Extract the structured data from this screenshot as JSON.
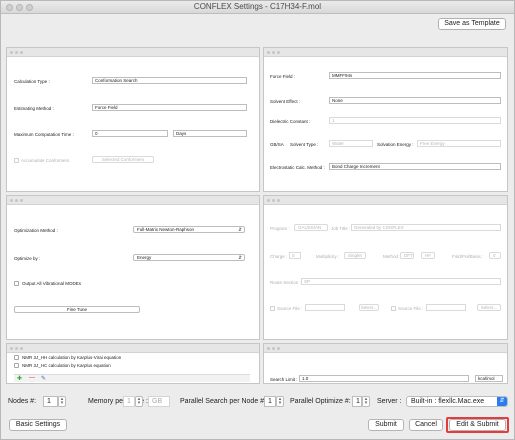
{
  "window": {
    "title": "CONFLEX Settings - C17H34-F.mol"
  },
  "toolbar": {
    "save_template": "Save as Template"
  },
  "panel_calc": {
    "calc_type_label": "Calculation Type :",
    "calc_type_value": "Conformation Search",
    "est_method_label": "Estimating Method :",
    "est_method_value": "Force Field",
    "max_time_label": "Maximum Computation Time :",
    "max_time_value": "0",
    "max_time_unit": "Days",
    "accumulate_label": "Accumulate Conformers",
    "selected_conformers": "Selected Conformers"
  },
  "panel_ff": {
    "ff_label": "Force Field :",
    "ff_value": "MMFF94s",
    "solvent_label": "Solvent Effect :",
    "solvent_value": "None",
    "dielectric_label": "Dielectric Constant :",
    "dielectric_value": "1",
    "gbsa_label": "GB/SA",
    "solvent_type_label": "Solvent Type :",
    "solvent_type_value": "Water",
    "solvation_energy_label": "Solvation Energy :",
    "solvation_energy_value": "Free Energy",
    "electrostatic_label": "Electrostatic Calc. Method :",
    "electrostatic_value": "Bond Charge Increment"
  },
  "panel_opt": {
    "opt_method_label": "Optimization Method :",
    "opt_method_value": "Full-Matrix Newton-Raphson",
    "optimize_by_label": "Optimize by :",
    "optimize_by_value": "Energy",
    "output_modes_label": "Output All Vibrational MODEs",
    "fine_tune": "Fine Tune"
  },
  "panel_program": {
    "program_label": "Program :",
    "program_value": "GAUSSIAN",
    "job_title_label": "Job Title :",
    "job_title_value": "Generated by CONFLEX",
    "charge_label": "Charge :",
    "charge_value": "0",
    "multiplicity_label": "Multiplicity :",
    "multiplicity_value": "Singlet",
    "method_label": "Method :",
    "method_value": "DFT",
    "functional_value": "HF",
    "basis_label": "Fold/Pol/Basis :",
    "basis_value": "0",
    "route_label": "Route Section :",
    "route_value": "SP",
    "source_file_label": "Source File :",
    "source_file_value": "Select...",
    "source_file2_label": "Source File :",
    "source_file2_value": "Select..."
  },
  "panel_nmr": {
    "nmr_hh": "NMR 3J_HH calculation by Karplus-Virai equation",
    "nmr_hc": "NMR 3J_HC calculation by Karplus equation"
  },
  "panel_search": {
    "search_limit_label": "Search Limit :",
    "search_limit_value": "1.0",
    "search_limit_unit": "kcal/mol"
  },
  "bottom": {
    "nodes_label": "Nodes #:",
    "nodes_value": "1",
    "mem_label": "Memory per Node :",
    "mem_value": "1",
    "mem_unit": "GB",
    "parallel_search_label": "Parallel Search per Node #:",
    "parallel_search_value": "1",
    "parallel_opt_label": "Parallel Optimize #:",
    "parallel_opt_value": "1",
    "server_label": "Server :",
    "server_value": "Built-in : flexllc.Mac.exe"
  },
  "footer": {
    "basic_settings": "Basic Settings",
    "submit": "Submit",
    "cancel": "Cancel",
    "edit_submit": "Edit & Submit"
  },
  "colors": {
    "accent": "#2b7cf0",
    "highlight": "#e23c3c"
  }
}
